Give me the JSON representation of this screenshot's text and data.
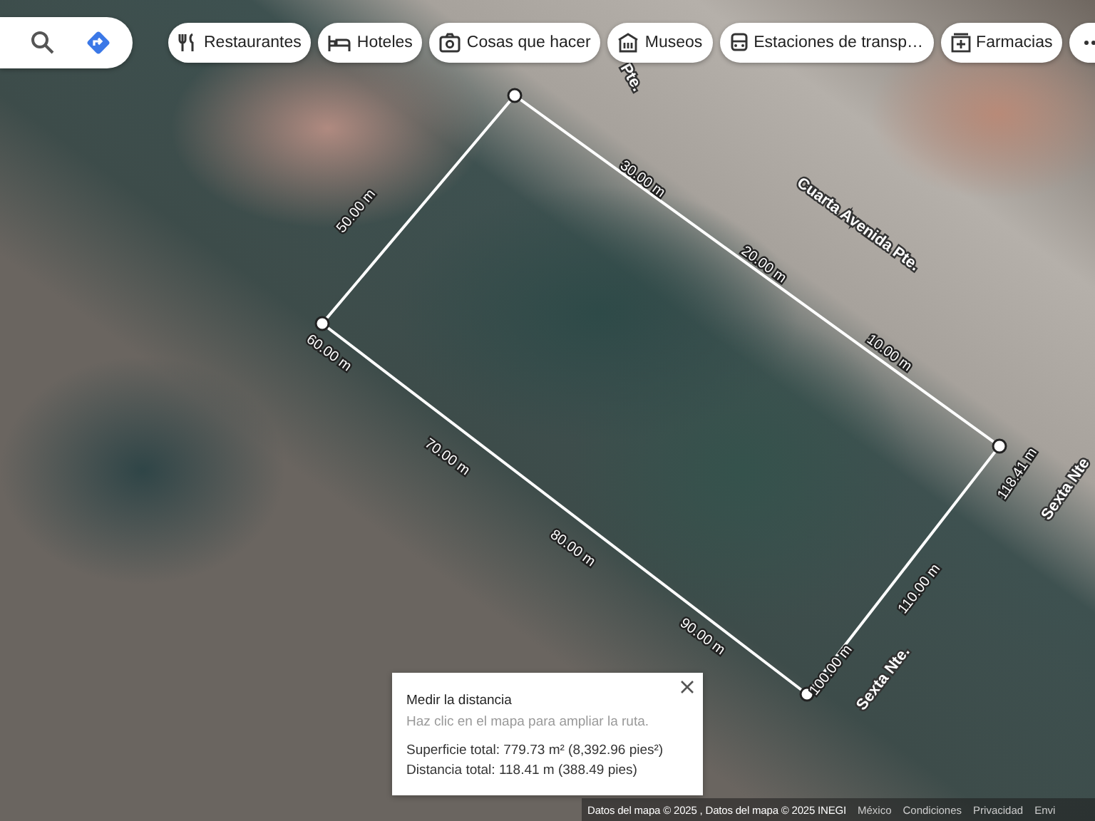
{
  "top_bar": {
    "chips": [
      {
        "kind": "restaurants",
        "label": "Restaurantes"
      },
      {
        "kind": "hotels",
        "label": "Hoteles"
      },
      {
        "kind": "things",
        "label": "Cosas que hacer"
      },
      {
        "kind": "museums",
        "label": "Museos"
      },
      {
        "kind": "transit",
        "label": "Estaciones de transp…"
      },
      {
        "kind": "pharmacy",
        "label": "Farmacias"
      },
      {
        "kind": "more"
      }
    ]
  },
  "map": {
    "street_labels": [
      "Pte.",
      "Cuarta Avenida Pte.",
      "Sexta Nte.",
      "Sexta Nte"
    ],
    "distance_labels": [
      "10.00 m",
      "20.00 m",
      "30.00 m",
      "50.00 m",
      "60.00 m",
      "70.00 m",
      "80.00 m",
      "90.00 m",
      "100.00 m",
      "110.00 m",
      "118.41 m"
    ]
  },
  "measure_panel": {
    "title": "Medir la distancia",
    "hint": "Haz clic en el mapa para ampliar la ruta.",
    "area": "Superficie total: 779.73 m² (8,392.96 pies²)",
    "distance": "Distancia total: 118.41 m (388.49 pies)"
  },
  "footer": {
    "attribution": "Datos del mapa © 2025 , Datos del mapa © 2025 INEGI",
    "links": [
      "México",
      "Condiciones",
      "Privacidad",
      "Envi"
    ]
  }
}
